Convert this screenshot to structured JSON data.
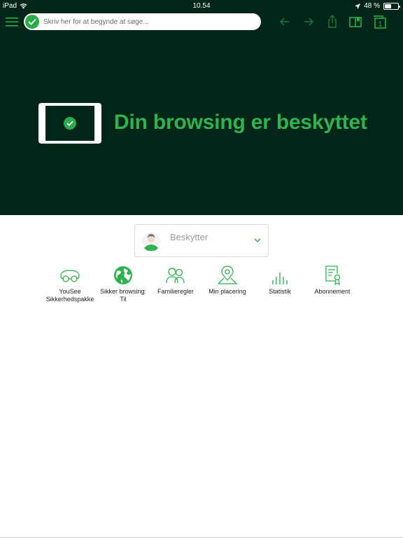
{
  "status": {
    "device": "iPad",
    "time": "10.54",
    "battery_text": "48 %",
    "battery_level": 0.48
  },
  "toolbar": {
    "search_placeholder": "Skriv her for at begynde at søge...",
    "tabs_count": "1"
  },
  "hero": {
    "title": "Din browsing er beskyttet"
  },
  "profile": {
    "name": "Beskytter"
  },
  "features": [
    {
      "label": "YouSee\nSikkerhedspakke",
      "icon": "car-wheel-icon"
    },
    {
      "label": "Sikker browsing:\nTil",
      "icon": "globe-icon"
    },
    {
      "label": "Familieregler",
      "icon": "family-icon"
    },
    {
      "label": "Min placering",
      "icon": "location-pin-icon"
    },
    {
      "label": "Statistik",
      "icon": "bar-chart-icon"
    },
    {
      "label": "Abonnement",
      "icon": "certificate-icon"
    }
  ],
  "colors": {
    "dark_background": "#002619",
    "accent_green": "#2fb34f"
  }
}
